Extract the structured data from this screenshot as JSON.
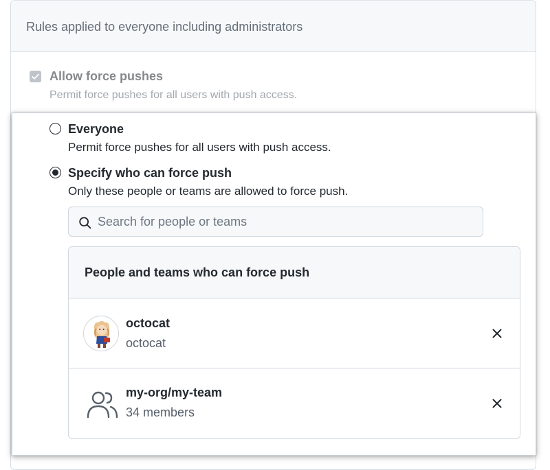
{
  "background": {
    "header_title": "Rules applied to everyone including administrators",
    "rule": {
      "label": "Allow force pushes",
      "description": "Permit force pushes for all users with push access.",
      "checked": true
    }
  },
  "dialog": {
    "options": [
      {
        "label": "Everyone",
        "description": "Permit force pushes for all users with push access.",
        "selected": false
      },
      {
        "label": "Specify who can force push",
        "description": "Only these people or teams are allowed to force push.",
        "selected": true
      }
    ],
    "search": {
      "placeholder": "Search for people or teams",
      "value": ""
    },
    "list": {
      "header": "People and teams who can force push",
      "items": [
        {
          "type": "user",
          "name": "octocat",
          "subtitle": "octocat",
          "icon": "avatar-octocat"
        },
        {
          "type": "team",
          "name": "my-org/my-team",
          "subtitle": "34 members",
          "icon": "people-icon"
        }
      ]
    }
  },
  "colors": {
    "text": "#24292f",
    "muted": "#57606a",
    "border": "#d0d7de",
    "subtle_bg": "#f6f8fa"
  }
}
